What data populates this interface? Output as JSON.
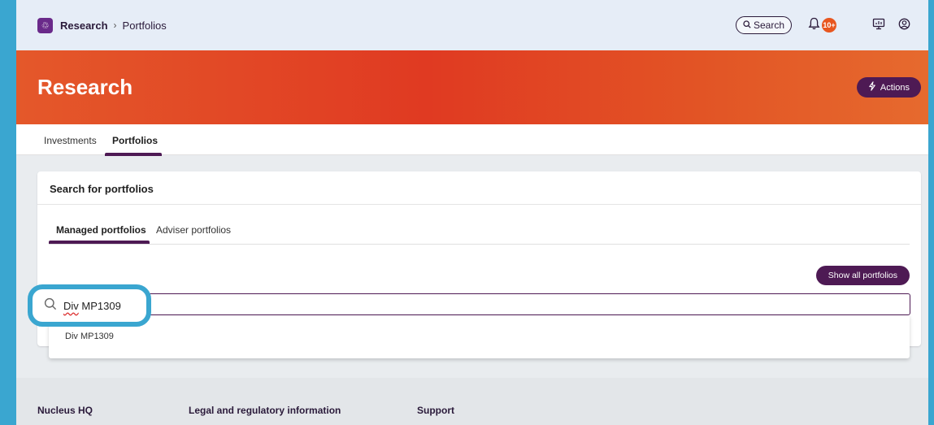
{
  "topbar": {
    "app_logo_glyph": "♲",
    "breadcrumb_root": "Research",
    "breadcrumb_separator": "›",
    "breadcrumb_current": "Portfolios",
    "search_label": "Search",
    "notification_count": "10+",
    "icons": [
      "flask-icon",
      "search-icon",
      "bell-icon",
      "screen-icon",
      "user-icon"
    ]
  },
  "hero": {
    "title": "Research",
    "actions_label": "Actions"
  },
  "main_tabs": [
    {
      "label": "Investments",
      "active": false
    },
    {
      "label": "Portfolios",
      "active": true
    }
  ],
  "card": {
    "title": "Search for portfolios",
    "sub_tabs": [
      {
        "label": "Managed portfolios",
        "active": true
      },
      {
        "label": "Adviser portfolios",
        "active": false
      }
    ],
    "show_all_label": "Show all portfolios",
    "search_value_misspelled": "Div",
    "search_value_rest": " MP1309",
    "dropdown_items": [
      "Div MP1309"
    ]
  },
  "footer": {
    "links": [
      "Nucleus HQ",
      "Legal and regulatory information",
      "Support"
    ]
  },
  "colors": {
    "accent": "#4e1a54",
    "hero_orange": "#e03a22",
    "badge": "#e8561f",
    "annotation": "#3aa6d0"
  }
}
